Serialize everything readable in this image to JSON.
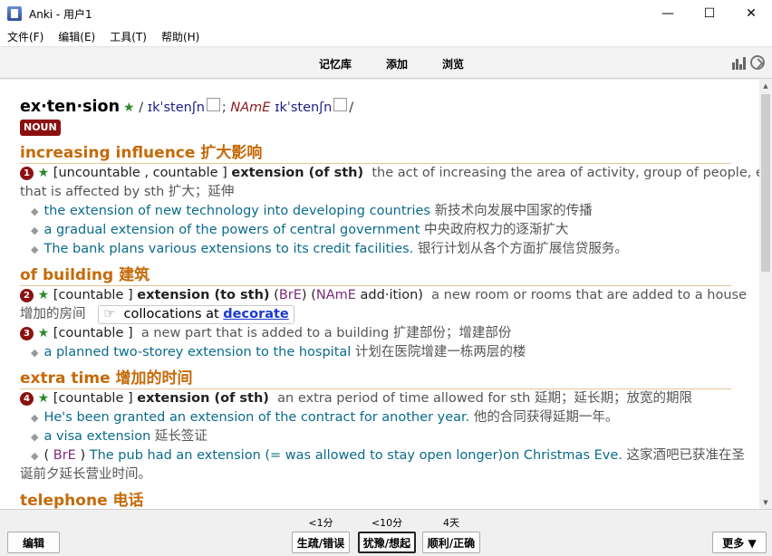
{
  "window": {
    "title": "Anki - 用户1",
    "minimize": "—",
    "maximize": "☐",
    "close": "✕"
  },
  "menu": [
    "文件(F)",
    "编辑(E)",
    "工具(T)",
    "帮助(H)"
  ],
  "toolbar": {
    "decks": "记忆库",
    "add": "添加",
    "browse": "浏览"
  },
  "entry": {
    "headword": "ex·ten·sion",
    "star": "★",
    "phon_uk": "ɪkˈstenʃn",
    "name_label": "NAmE",
    "phon_us": "ɪkˈstenʃn",
    "slash1": "/",
    "semi": ";",
    "slash2": "/",
    "pos": "NOUN",
    "senses": [
      {
        "heading": "increasing influence 扩大影响",
        "num": "1",
        "grammar": "[uncountable , countable ]",
        "term": "extension (of sth)",
        "def": "the act of increasing the area of activity, group of people, etc.",
        "def2": "that is affected by sth 扩大；延伸",
        "examples": [
          {
            "en": "the extension of new technology into developing countries",
            "zh": "新技术向发展中国家的传播"
          },
          {
            "en": "a gradual extension of the powers of central government",
            "zh": "中央政府权力的逐渐扩大"
          },
          {
            "en": "The bank plans various extensions to its credit facilities.",
            "zh": "银行计划从各个方面扩展信贷服务。"
          }
        ]
      },
      {
        "heading": "of building 建筑",
        "num": "2",
        "grammar": "[countable ]",
        "term": "extension (to sth)",
        "bre": "BrE",
        "name": "NAmE",
        "addition": "add·ition",
        "def": "a new room or rooms that are added to a house",
        "def2": "增加的房间",
        "collo_icon": "☞",
        "collo_text": "collocations at",
        "collo_link": "decorate"
      },
      {
        "num": "3",
        "grammar": "[countable ]",
        "def": "a new part that is added to a building",
        "zh": "扩建部份；增建部份",
        "examples": [
          {
            "en": "a planned two-storey extension to the hospital",
            "zh": "计划在医院增建一栋两层的楼"
          }
        ]
      },
      {
        "heading": "extra time 增加的时间",
        "num": "4",
        "grammar": "[countable ]",
        "term": "extension (of sth)",
        "def": "an extra period of time allowed for sth",
        "zh": "延期；延长期；放宽的期限",
        "examples": [
          {
            "en": "He's been granted an extension of the contract for another year.",
            "zh": "他的合同获得延期一年。"
          },
          {
            "en": "a visa extension",
            "zh": "延长签证"
          },
          {
            "pre": "(",
            "bre": "BrE",
            "post": ")",
            "en": "The pub had an extension (= was allowed to stay open longer)on Christmas Eve.",
            "zh": "这家酒吧已获准在圣",
            "zh2": "诞前夕延长营业时间。"
          }
        ]
      },
      {
        "heading": "telephone 电话"
      }
    ]
  },
  "bottom": {
    "edit": "编辑",
    "more": "更多 ▼",
    "answers": [
      {
        "ivl": "<1分",
        "label": "生疏/错误"
      },
      {
        "ivl": "<10分",
        "label": "犹豫/想起"
      },
      {
        "ivl": "4天",
        "label": "顺利/正确"
      }
    ]
  }
}
